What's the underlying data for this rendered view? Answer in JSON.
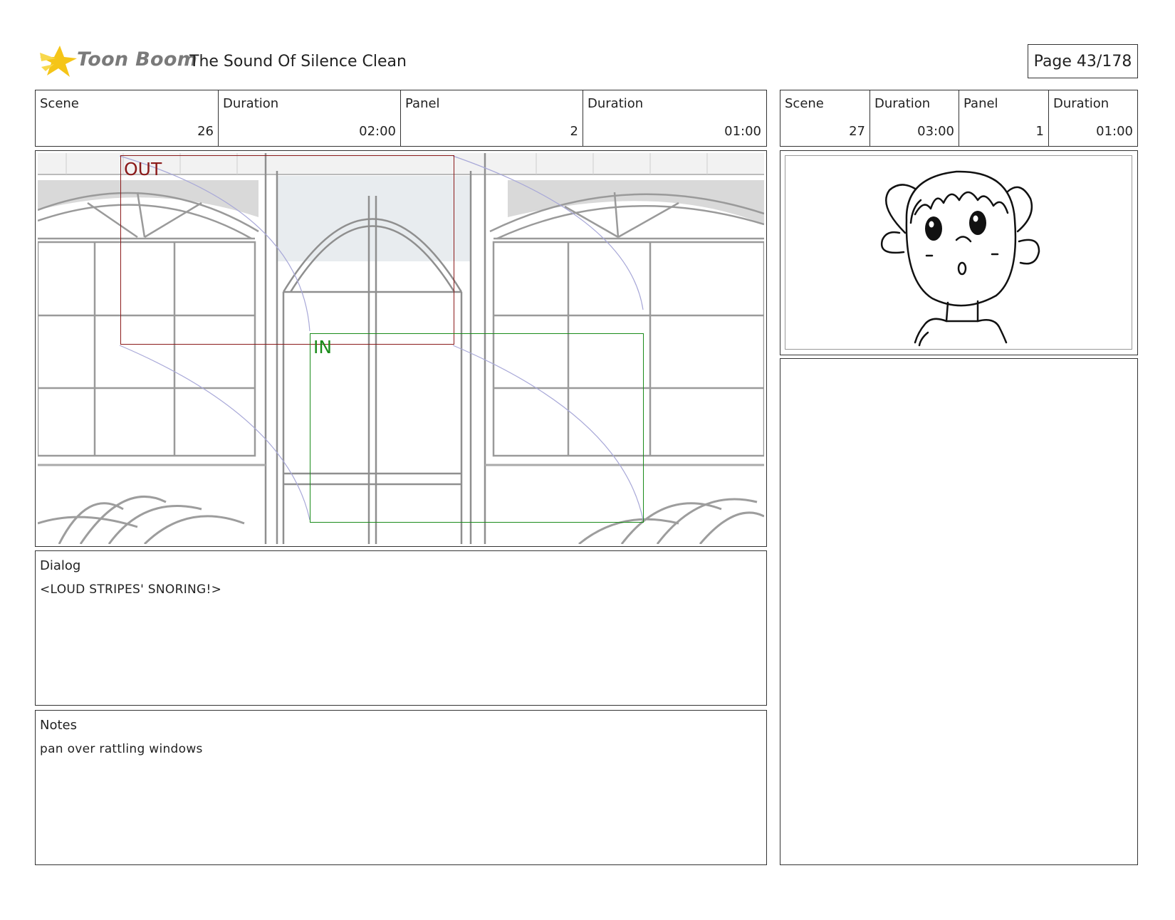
{
  "header": {
    "logo_text": "Toon Boom",
    "project_title": "The Sound Of Silence  Clean",
    "page_label": "Page  43/178"
  },
  "left_panel": {
    "info": [
      {
        "label": "Scene",
        "value": "26"
      },
      {
        "label": "Duration",
        "value": "02:00"
      },
      {
        "label": "Panel",
        "value": "2"
      },
      {
        "label": "Duration",
        "value": "01:00"
      }
    ],
    "camera": {
      "out_label": "OUT",
      "in_label": "IN",
      "out_color": "#8b1a1a",
      "in_color": "#1a8b1a"
    },
    "dialog_label": "Dialog",
    "dialog_text": "<LOUD STRIPES' SNORING!>",
    "notes_label": "Notes",
    "notes_text": "pan over rattling windows"
  },
  "right_panel": {
    "info": [
      {
        "label": "Scene",
        "value": "27"
      },
      {
        "label": "Duration",
        "value": "03:00"
      },
      {
        "label": "Panel",
        "value": "1"
      },
      {
        "label": "Duration",
        "value": "01:00"
      }
    ]
  },
  "colors": {
    "logo_star": "#f5c518",
    "border": "#333333"
  }
}
